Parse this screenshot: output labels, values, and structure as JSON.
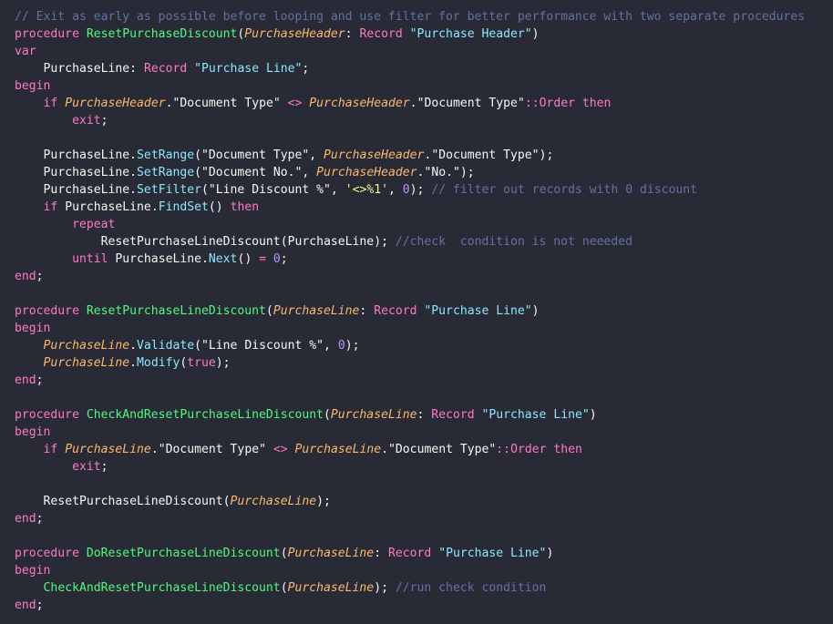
{
  "editor": {
    "theme_colors": {
      "background": "#282a36",
      "comment": "#6272a4",
      "keyword": "#ff79c6",
      "procedure_name": "#50fa7b",
      "method": "#8be9fd",
      "parameter": "#ffb86c",
      "string": "#8be9fd",
      "number": "#bd93f9",
      "text": "#f8f8f2"
    },
    "lines": [
      [
        [
          "comment",
          "// Exit as early as possible before looping and use filter for better performance with two separate procedures"
        ]
      ],
      [
        [
          "keyword",
          "procedure"
        ],
        [
          "text",
          " "
        ],
        [
          "proc",
          "ResetPurchaseDiscount"
        ],
        [
          "punct",
          "("
        ],
        [
          "param",
          "PurchaseHeader"
        ],
        [
          "punct",
          ": "
        ],
        [
          "keyword",
          "Record"
        ],
        [
          "text",
          " "
        ],
        [
          "string",
          "\"Purchase Header\""
        ],
        [
          "punct",
          ")"
        ]
      ],
      [
        [
          "keyword",
          "var"
        ]
      ],
      [
        [
          "text",
          "    "
        ],
        [
          "ident",
          "PurchaseLine"
        ],
        [
          "punct",
          ": "
        ],
        [
          "keyword",
          "Record"
        ],
        [
          "text",
          " "
        ],
        [
          "string",
          "\"Purchase Line\""
        ],
        [
          "punct",
          ";"
        ]
      ],
      [
        [
          "keyword",
          "begin"
        ]
      ],
      [
        [
          "text",
          "    "
        ],
        [
          "keyword",
          "if"
        ],
        [
          "text",
          " "
        ],
        [
          "param",
          "PurchaseHeader"
        ],
        [
          "punct",
          "."
        ],
        [
          "text",
          "\"Document Type\""
        ],
        [
          "text",
          " "
        ],
        [
          "operator",
          "<>"
        ],
        [
          "text",
          " "
        ],
        [
          "param",
          "PurchaseHeader"
        ],
        [
          "punct",
          "."
        ],
        [
          "text",
          "\"Document Type\""
        ],
        [
          "operator",
          "::"
        ],
        [
          "keyword",
          "Order"
        ],
        [
          "text",
          " "
        ],
        [
          "keyword",
          "then"
        ]
      ],
      [
        [
          "text",
          "        "
        ],
        [
          "keyword",
          "exit"
        ],
        [
          "punct",
          ";"
        ]
      ],
      [],
      [
        [
          "text",
          "    "
        ],
        [
          "ident",
          "PurchaseLine"
        ],
        [
          "punct",
          "."
        ],
        [
          "method",
          "SetRange"
        ],
        [
          "punct",
          "("
        ],
        [
          "text",
          "\"Document Type\""
        ],
        [
          "punct",
          ", "
        ],
        [
          "param",
          "PurchaseHeader"
        ],
        [
          "punct",
          "."
        ],
        [
          "text",
          "\"Document Type\""
        ],
        [
          "punct",
          ");"
        ]
      ],
      [
        [
          "text",
          "    "
        ],
        [
          "ident",
          "PurchaseLine"
        ],
        [
          "punct",
          "."
        ],
        [
          "method",
          "SetRange"
        ],
        [
          "punct",
          "("
        ],
        [
          "text",
          "\"Document No.\""
        ],
        [
          "punct",
          ", "
        ],
        [
          "param",
          "PurchaseHeader"
        ],
        [
          "punct",
          "."
        ],
        [
          "text",
          "\"No.\""
        ],
        [
          "punct",
          ");"
        ]
      ],
      [
        [
          "text",
          "    "
        ],
        [
          "ident",
          "PurchaseLine"
        ],
        [
          "punct",
          "."
        ],
        [
          "method",
          "SetFilter"
        ],
        [
          "punct",
          "("
        ],
        [
          "text",
          "\"Line Discount %\""
        ],
        [
          "punct",
          ", "
        ],
        [
          "string2",
          "'<>%1'"
        ],
        [
          "punct",
          ", "
        ],
        [
          "number",
          "0"
        ],
        [
          "punct",
          ");"
        ],
        [
          "text",
          " "
        ],
        [
          "comment",
          "// filter out records with 0 discount"
        ]
      ],
      [
        [
          "text",
          "    "
        ],
        [
          "keyword",
          "if"
        ],
        [
          "text",
          " "
        ],
        [
          "ident",
          "PurchaseLine"
        ],
        [
          "punct",
          "."
        ],
        [
          "method",
          "FindSet"
        ],
        [
          "punct",
          "()"
        ],
        [
          "text",
          " "
        ],
        [
          "keyword",
          "then"
        ]
      ],
      [
        [
          "text",
          "        "
        ],
        [
          "keyword",
          "repeat"
        ]
      ],
      [
        [
          "text",
          "            "
        ],
        [
          "ident",
          "ResetPurchaseLineDiscount"
        ],
        [
          "punct",
          "("
        ],
        [
          "ident",
          "PurchaseLine"
        ],
        [
          "punct",
          ");"
        ],
        [
          "text",
          " "
        ],
        [
          "comment",
          "//check  condition is not neeeded"
        ]
      ],
      [
        [
          "text",
          "        "
        ],
        [
          "keyword",
          "until"
        ],
        [
          "text",
          " "
        ],
        [
          "ident",
          "PurchaseLine"
        ],
        [
          "punct",
          "."
        ],
        [
          "method",
          "Next"
        ],
        [
          "punct",
          "()"
        ],
        [
          "text",
          " "
        ],
        [
          "operator",
          "="
        ],
        [
          "text",
          " "
        ],
        [
          "number",
          "0"
        ],
        [
          "punct",
          ";"
        ]
      ],
      [
        [
          "keyword",
          "end"
        ],
        [
          "punct",
          ";"
        ]
      ],
      [],
      [
        [
          "keyword",
          "procedure"
        ],
        [
          "text",
          " "
        ],
        [
          "proc",
          "ResetPurchaseLineDiscount"
        ],
        [
          "punct",
          "("
        ],
        [
          "param",
          "PurchaseLine"
        ],
        [
          "punct",
          ": "
        ],
        [
          "keyword",
          "Record"
        ],
        [
          "text",
          " "
        ],
        [
          "string",
          "\"Purchase Line\""
        ],
        [
          "punct",
          ")"
        ]
      ],
      [
        [
          "keyword",
          "begin"
        ]
      ],
      [
        [
          "text",
          "    "
        ],
        [
          "param",
          "PurchaseLine"
        ],
        [
          "punct",
          "."
        ],
        [
          "method",
          "Validate"
        ],
        [
          "punct",
          "("
        ],
        [
          "text",
          "\"Line Discount %\""
        ],
        [
          "punct",
          ", "
        ],
        [
          "number",
          "0"
        ],
        [
          "punct",
          ");"
        ]
      ],
      [
        [
          "text",
          "    "
        ],
        [
          "param",
          "PurchaseLine"
        ],
        [
          "punct",
          "."
        ],
        [
          "method",
          "Modify"
        ],
        [
          "punct",
          "("
        ],
        [
          "keyword",
          "true"
        ],
        [
          "punct",
          ");"
        ]
      ],
      [
        [
          "keyword",
          "end"
        ],
        [
          "punct",
          ";"
        ]
      ],
      [],
      [
        [
          "keyword",
          "procedure"
        ],
        [
          "text",
          " "
        ],
        [
          "proc",
          "CheckAndResetPurchaseLineDiscount"
        ],
        [
          "punct",
          "("
        ],
        [
          "param",
          "PurchaseLine"
        ],
        [
          "punct",
          ": "
        ],
        [
          "keyword",
          "Record"
        ],
        [
          "text",
          " "
        ],
        [
          "string",
          "\"Purchase Line\""
        ],
        [
          "punct",
          ")"
        ]
      ],
      [
        [
          "keyword",
          "begin"
        ]
      ],
      [
        [
          "text",
          "    "
        ],
        [
          "keyword",
          "if"
        ],
        [
          "text",
          " "
        ],
        [
          "param",
          "PurchaseLine"
        ],
        [
          "punct",
          "."
        ],
        [
          "text",
          "\"Document Type\""
        ],
        [
          "text",
          " "
        ],
        [
          "operator",
          "<>"
        ],
        [
          "text",
          " "
        ],
        [
          "param",
          "PurchaseLine"
        ],
        [
          "punct",
          "."
        ],
        [
          "text",
          "\"Document Type\""
        ],
        [
          "operator",
          "::"
        ],
        [
          "keyword",
          "Order"
        ],
        [
          "text",
          " "
        ],
        [
          "keyword",
          "then"
        ]
      ],
      [
        [
          "text",
          "        "
        ],
        [
          "keyword",
          "exit"
        ],
        [
          "punct",
          ";"
        ]
      ],
      [],
      [
        [
          "text",
          "    "
        ],
        [
          "ident",
          "ResetPurchaseLineDiscount"
        ],
        [
          "punct",
          "("
        ],
        [
          "param",
          "PurchaseLine"
        ],
        [
          "punct",
          ");"
        ]
      ],
      [
        [
          "keyword",
          "end"
        ],
        [
          "punct",
          ";"
        ]
      ],
      [],
      [
        [
          "keyword",
          "procedure"
        ],
        [
          "text",
          " "
        ],
        [
          "proc",
          "DoResetPurchaseLineDiscount"
        ],
        [
          "punct",
          "("
        ],
        [
          "param",
          "PurchaseLine"
        ],
        [
          "punct",
          ": "
        ],
        [
          "keyword",
          "Record"
        ],
        [
          "text",
          " "
        ],
        [
          "string",
          "\"Purchase Line\""
        ],
        [
          "punct",
          ")"
        ]
      ],
      [
        [
          "keyword",
          "begin"
        ]
      ],
      [
        [
          "text",
          "    "
        ],
        [
          "proc",
          "CheckAndResetPurchaseLineDiscount"
        ],
        [
          "punct",
          "("
        ],
        [
          "param",
          "PurchaseLine"
        ],
        [
          "punct",
          ");"
        ],
        [
          "text",
          " "
        ],
        [
          "comment",
          "//run check condition"
        ]
      ],
      [
        [
          "keyword",
          "end"
        ],
        [
          "punct",
          ";"
        ]
      ]
    ]
  }
}
